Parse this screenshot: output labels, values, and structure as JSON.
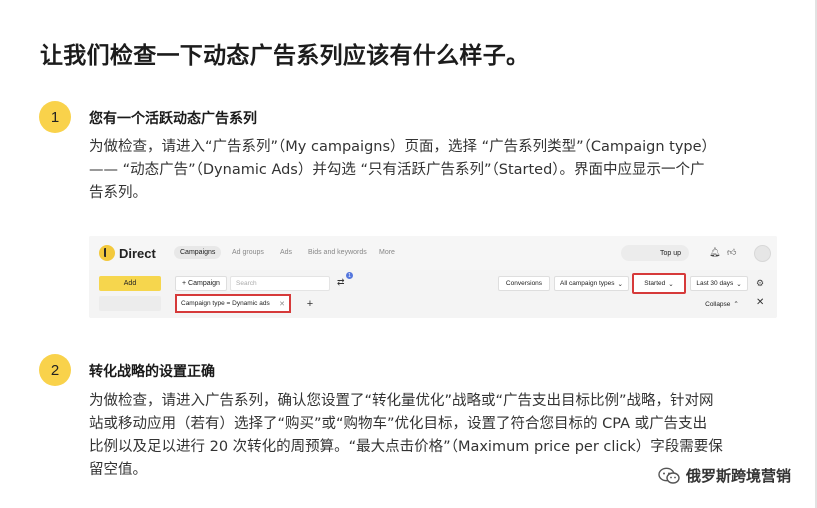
{
  "title": "让我们检查一下动态广告系列应该有什么样子。",
  "steps": [
    {
      "number": "1",
      "title": "您有一个活跃动态广告系列",
      "lines": [
        "为做检查，请进入“广告系列”（My campaigns）页面，选择 “广告系列类型”（Campaign type）",
        "—— “动态广告”（Dynamic Ads）并勾选 “只有活跃广告系列”（Started）。界面中应显示一个广",
        "告系列。"
      ]
    },
    {
      "number": "2",
      "title": "转化战略的设置正确",
      "lines": [
        "为做检查，请进入广告系列，确认您设置了“转化量优化”战略或“广告支出目标比例”战略，针对网",
        "站或移动应用（若有）选择了“购买”或“购物车”优化目标，设置了符合您目标的 CPA 或广告支出",
        "比例以及足以进行 20 次转化的周预算。“最大点击价格”（Maximum price per click）字段需要保",
        "留空值。"
      ]
    }
  ],
  "screenshot": {
    "logo": "Direct",
    "nav_tabs": [
      "Campaigns",
      "Ad groups",
      "Ads",
      "Bids and keywords",
      "More"
    ],
    "top_up": "Top up",
    "add_button": "Add",
    "campaign_button": "+ Campaign",
    "search_placeholder": "Search",
    "notification_count": "1",
    "conversions": "Conversions",
    "campaign_types": "All campaign types",
    "started": "Started",
    "date_range": "Last 30 days",
    "filter_chip": "Campaign type = Dynamic ads",
    "collapse": "Collapse"
  },
  "watermark": "俄罗斯跨境营销",
  "colors": {
    "accent_yellow": "#f9d24b",
    "highlight_red": "#d63a3a"
  }
}
